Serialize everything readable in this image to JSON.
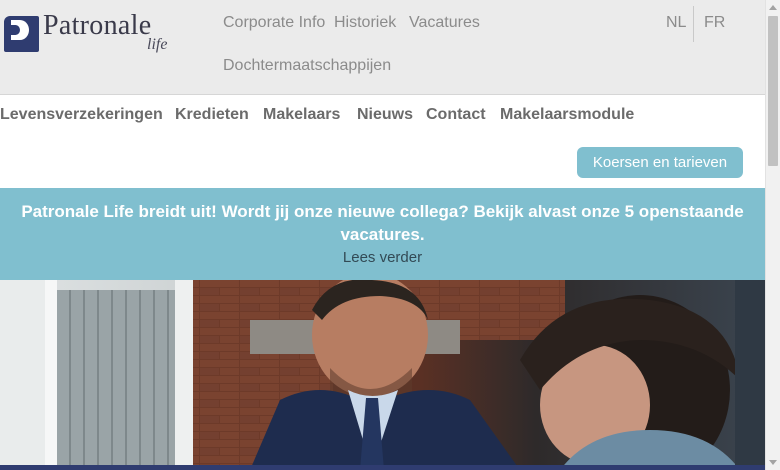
{
  "brand": {
    "name": "Patronale",
    "sub": "life"
  },
  "toplinks": [
    "Corporate Info",
    "Historiek",
    "Vacatures",
    "Dochtermaatschappijen"
  ],
  "languages": [
    "NL",
    "FR"
  ],
  "mainnav": [
    "Levensverzekeringen",
    "Kredieten",
    "Makelaars",
    "Nieuws",
    "Contact",
    "Makelaarsmodule"
  ],
  "cta": {
    "label": "Koersen en tarieven"
  },
  "banner": {
    "headline": "Patronale Life breidt uit! Wordt jij onze nieuwe collega? Bekijk alvast onze 5 openstaande vacatures.",
    "link": "Lees verder"
  },
  "colors": {
    "navy": "#2f3c70",
    "accent": "#80bfcf",
    "topbar": "#ebebeb",
    "nav_text": "#6b6b6b"
  }
}
